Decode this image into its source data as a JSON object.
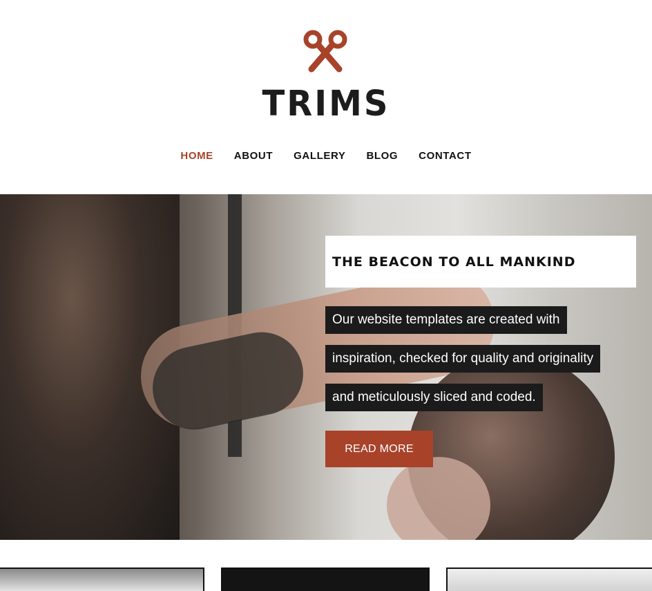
{
  "brand": {
    "name": "TRIMS",
    "logo_icon": "scissors-icon",
    "accent_color": "#a8432a"
  },
  "nav": {
    "items": [
      {
        "label": "HOME",
        "active": true
      },
      {
        "label": "ABOUT",
        "active": false
      },
      {
        "label": "GALLERY",
        "active": false
      },
      {
        "label": "BLOG",
        "active": false
      },
      {
        "label": "CONTACT",
        "active": false
      }
    ]
  },
  "hero": {
    "title": "THE BEACON TO ALL MANKIND",
    "lines": [
      "Our website templates are created with",
      "inspiration, checked for quality and originality",
      "and meticulously sliced and coded."
    ],
    "button_label": "READ MORE"
  }
}
